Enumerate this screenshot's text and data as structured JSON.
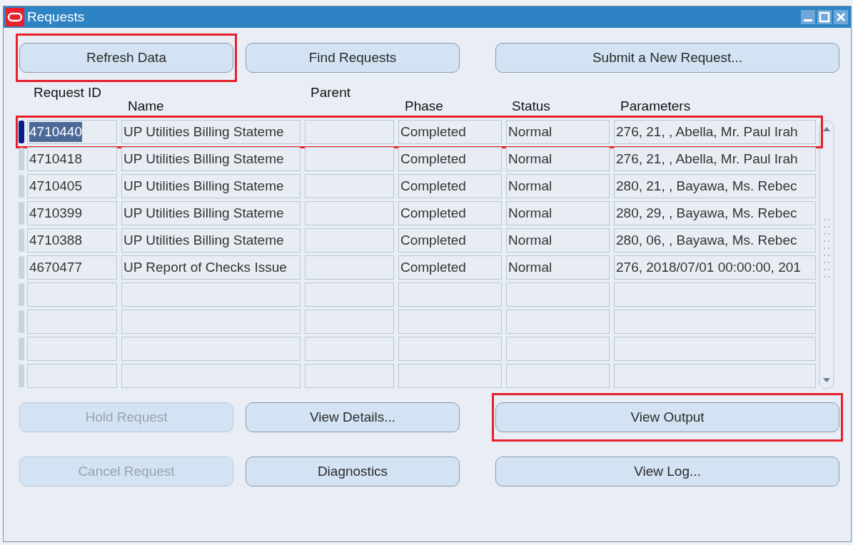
{
  "window": {
    "title": "Requests"
  },
  "top_buttons": [
    {
      "label": "Refresh Data",
      "disabled": false,
      "highlighted": true
    },
    {
      "label": "Find Requests",
      "disabled": false,
      "highlighted": false
    },
    {
      "label": "Submit a New Request...",
      "disabled": false,
      "highlighted": false
    }
  ],
  "table": {
    "group_headers": [
      "Request ID",
      "Parent"
    ],
    "columns": [
      "Name",
      "Phase",
      "Status",
      "Parameters"
    ],
    "rows": [
      {
        "selected": true,
        "highlighted": true,
        "request_id": "4710440",
        "name": "UP Utilities Billing Stateme",
        "phase": "Completed",
        "status": "Normal",
        "parameters": "276, 21, , Abella, Mr. Paul Irah"
      },
      {
        "selected": false,
        "highlighted": false,
        "request_id": "4710418",
        "name": "UP Utilities Billing Stateme",
        "phase": "Completed",
        "status": "Normal",
        "parameters": "276, 21, , Abella, Mr. Paul Irah"
      },
      {
        "selected": false,
        "highlighted": false,
        "request_id": "4710405",
        "name": "UP Utilities Billing Stateme",
        "phase": "Completed",
        "status": "Normal",
        "parameters": "280, 21, , Bayawa, Ms. Rebec"
      },
      {
        "selected": false,
        "highlighted": false,
        "request_id": "4710399",
        "name": "UP Utilities Billing Stateme",
        "phase": "Completed",
        "status": "Normal",
        "parameters": "280, 29, , Bayawa, Ms. Rebec"
      },
      {
        "selected": false,
        "highlighted": false,
        "request_id": "4710388",
        "name": "UP Utilities Billing Stateme",
        "phase": "Completed",
        "status": "Normal",
        "parameters": "280, 06, , Bayawa, Ms. Rebec"
      },
      {
        "selected": false,
        "highlighted": false,
        "request_id": "4670477",
        "name": "UP Report of Checks Issue",
        "phase": "Completed",
        "status": "Normal",
        "parameters": "276, 2018/07/01 00:00:00, 201"
      }
    ]
  },
  "bottom_buttons": [
    [
      {
        "label": "Hold Request",
        "disabled": true,
        "highlighted": false
      },
      {
        "label": "View Details...",
        "disabled": false,
        "highlighted": false
      },
      {
        "label": "View Output",
        "disabled": false,
        "highlighted": true
      }
    ],
    [
      {
        "label": "Cancel Request",
        "disabled": true,
        "highlighted": false
      },
      {
        "label": "Diagnostics",
        "disabled": false,
        "highlighted": false
      },
      {
        "label": "View Log...",
        "disabled": false,
        "highlighted": false
      }
    ]
  ]
}
